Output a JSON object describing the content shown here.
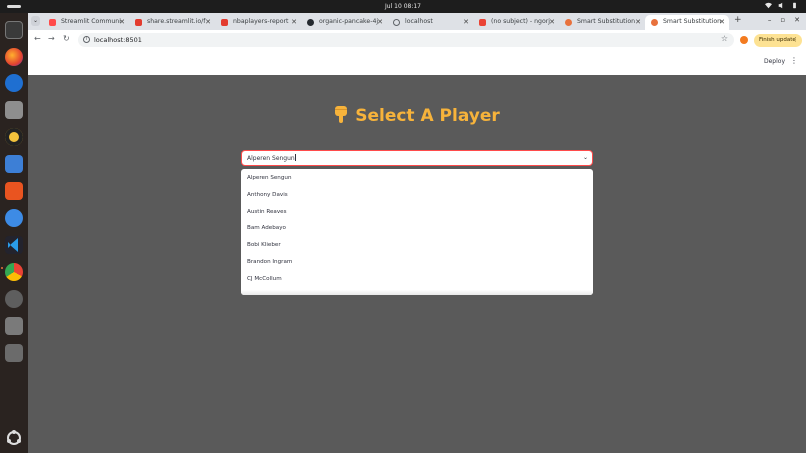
{
  "system": {
    "clock": "Jul 10  08:17"
  },
  "browser": {
    "tabs": [
      {
        "label": "Streamlit Communi",
        "favicon_color": "#ff4b4b"
      },
      {
        "label": "share.streamlit.io/f",
        "favicon_color": "#e33b2e"
      },
      {
        "label": "nbaplayers-report",
        "favicon_color": "#e33b2e"
      },
      {
        "label": "organic-pancake-4j",
        "favicon_color": "#24292f"
      },
      {
        "label": "localhost",
        "favicon_color": "#5f6368"
      },
      {
        "label": "(no subject) - ngorj",
        "favicon_color": "#ea4335"
      },
      {
        "label": "Smart Substitution",
        "favicon_color": "#e8713c"
      },
      {
        "label": "Smart Substitution",
        "favicon_color": "#e8713c",
        "active": true
      }
    ],
    "url": "localhost:8501",
    "finish_update_label": "Finish update"
  },
  "app": {
    "deploy_label": "Deploy",
    "title": "Select A Player",
    "select_value": "Alperen Sengun",
    "options": [
      "Alperen Sengun",
      "Anthony Davis",
      "Austin Reaves",
      "Bam Adebayo",
      "Bobi Klieber",
      "Brandon Ingram",
      "CJ McCollum"
    ],
    "accent_color": "#f7b33b",
    "focus_color": "#ff4b4b"
  }
}
